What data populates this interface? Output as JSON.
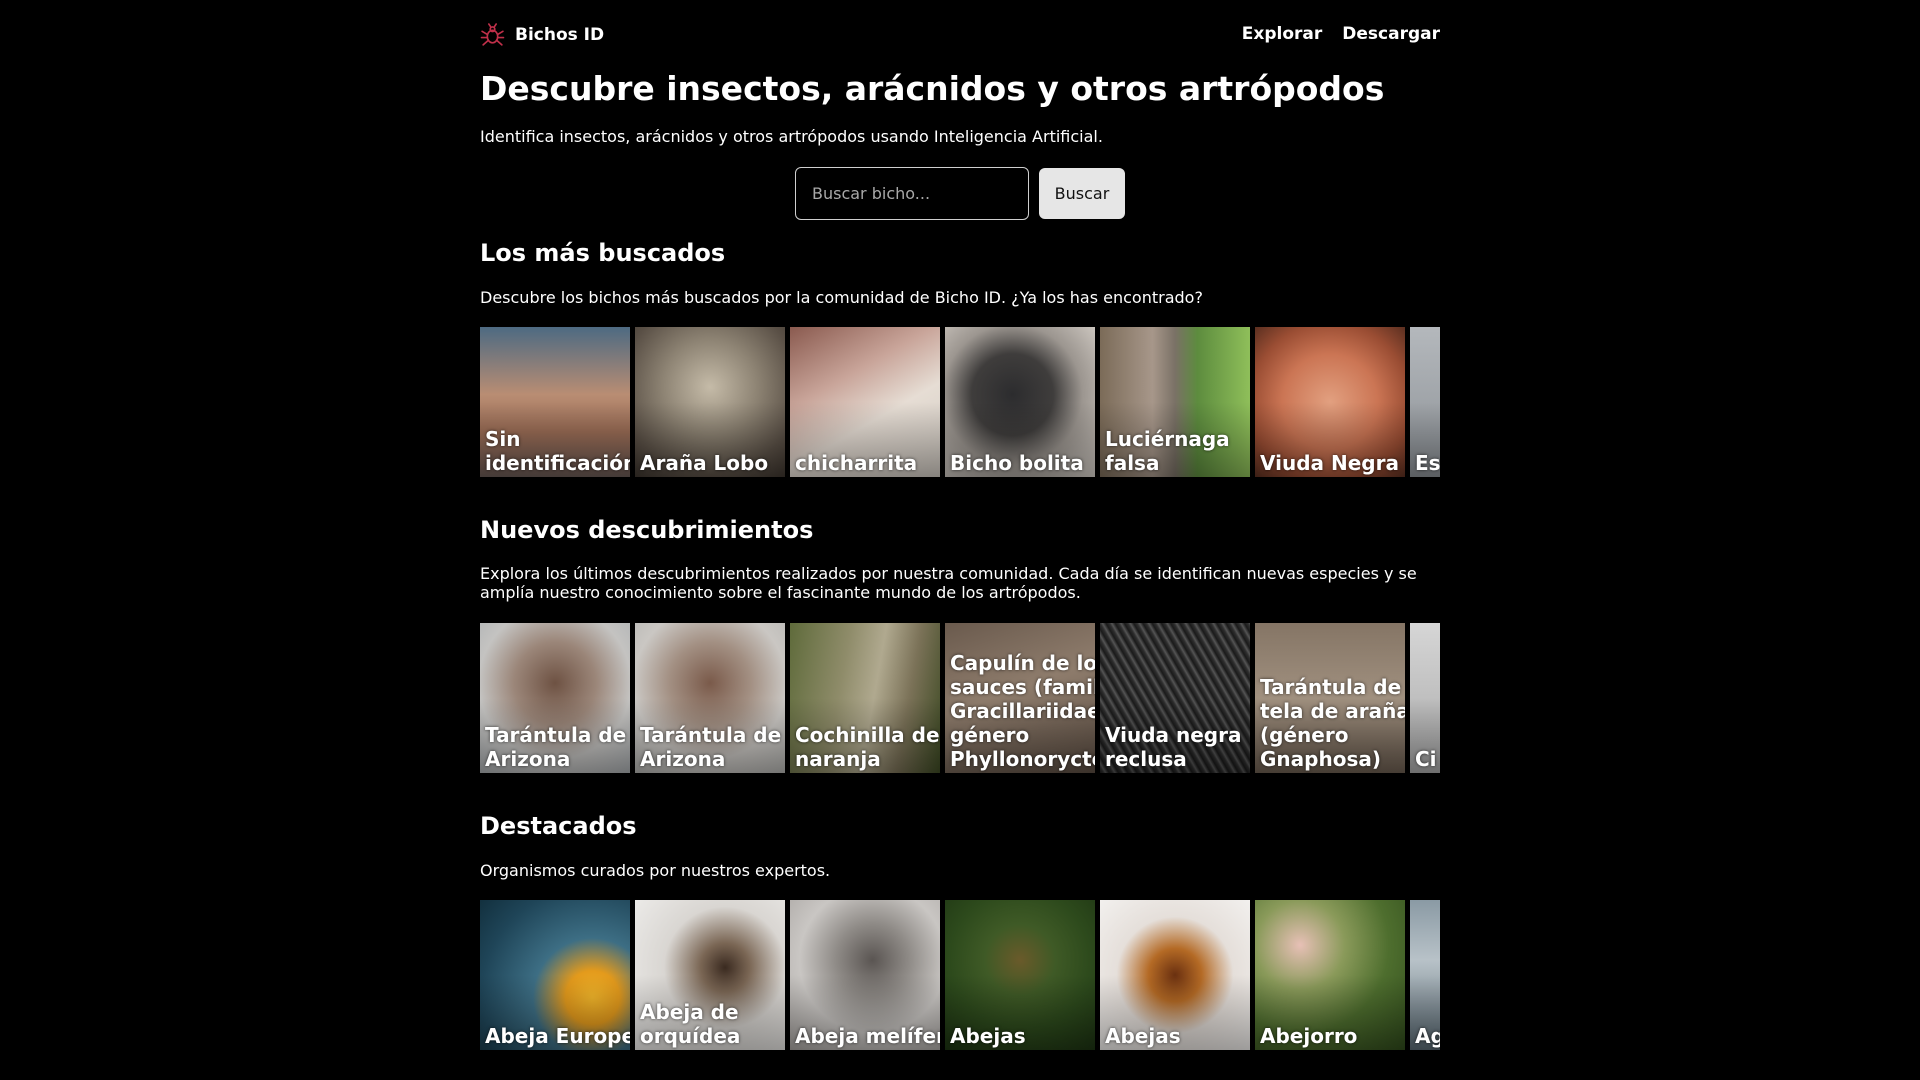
{
  "header": {
    "brand": "Bichos ID",
    "nav": [
      {
        "label": "Explorar"
      },
      {
        "label": "Descargar"
      }
    ]
  },
  "hero": {
    "title": "Descubre insectos, arácnidos y otros artrópodos",
    "subtitle": "Identifica insectos, arácnidos y otros artrópodos usando Inteligencia Artificial.",
    "search_placeholder": "Buscar bicho...",
    "search_value": "",
    "search_button": "Buscar"
  },
  "colors": {
    "background": "#000000",
    "text": "#ffffff",
    "logo_accent": "#c0304a",
    "button_bg": "#e6e6e6"
  },
  "sections": [
    {
      "title": "Los más buscados",
      "description": "Descubre los bichos más buscados por la comunidad de Bicho ID. ¿Ya los has encontrado?",
      "cards": [
        {
          "label": "Sin identificación",
          "photo": "insect-photo"
        },
        {
          "label": "Araña Lobo",
          "photo": "insect-photo"
        },
        {
          "label": "chicharrita",
          "photo": "insect-photo"
        },
        {
          "label": "Bicho bolita",
          "photo": "insect-photo"
        },
        {
          "label": "Luciérnaga falsa",
          "photo": "insect-photo"
        },
        {
          "label": "Viuda Negra",
          "photo": "insect-photo"
        },
        {
          "label": "Es de",
          "photo": "insect-photo"
        }
      ]
    },
    {
      "title": "Nuevos descubrimientos",
      "description": "Explora los últimos descubrimientos realizados por nuestra comunidad. Cada día se identifican nuevas especies y se amplía nuestro conocimiento sobre el fascinante mundo de los artrópodos.",
      "cards": [
        {
          "label": "Tarántula de Arizona",
          "photo": "insect-photo"
        },
        {
          "label": "Tarántula de Arizona",
          "photo": "insect-photo"
        },
        {
          "label": "Cochinilla de la naranja",
          "photo": "insect-photo"
        },
        {
          "label": "Capulín de los sauces (familia Gracillariidae género Phyllonorycte",
          "photo": "insect-photo"
        },
        {
          "label": "Viuda negra reclusa",
          "photo": "insect-photo"
        },
        {
          "label": "Tarántula de tela de araña (género Gnaphosa)",
          "photo": "insect-photo"
        },
        {
          "label": "Ci ve",
          "photo": "insect-photo"
        }
      ]
    },
    {
      "title": "Destacados",
      "description": "Organismos curados por nuestros expertos.",
      "cards": [
        {
          "label": "Abeja Europea",
          "photo": "insect-photo"
        },
        {
          "label": "Abeja de orquídea",
          "photo": "insect-photo"
        },
        {
          "label": "Abeja melífera",
          "photo": "insect-photo"
        },
        {
          "label": "Abejas",
          "photo": "insect-photo"
        },
        {
          "label": "Abejas",
          "photo": "insect-photo"
        },
        {
          "label": "Abejorro",
          "photo": "insect-photo"
        },
        {
          "label": "Ag ce",
          "photo": "insect-photo"
        }
      ]
    }
  ]
}
